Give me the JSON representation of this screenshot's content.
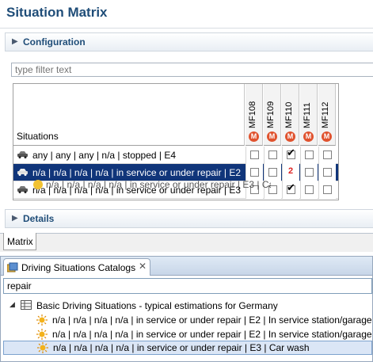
{
  "editor": {
    "title": "Situation Matrix",
    "configuration_label": "Configuration",
    "details_label": "Details",
    "filter_placeholder": "type filter text",
    "matrix_tab_label": "Matrix"
  },
  "matrix": {
    "situations_header": "Situations",
    "columns": [
      {
        "label": "MF108",
        "icon": "M"
      },
      {
        "label": "MF109",
        "icon": "M"
      },
      {
        "label": "MF110",
        "icon": "M"
      },
      {
        "label": "MF111",
        "icon": "M"
      },
      {
        "label": "MF112",
        "icon": "M"
      }
    ],
    "rows": [
      {
        "label": "any | any | any | n/a | stopped | E4",
        "cells": [
          "",
          "",
          "check",
          "",
          ""
        ]
      },
      {
        "label": "n/a | n/a | n/a | n/a | in service or under repair | E2",
        "cells": [
          "",
          "",
          "2",
          "",
          ""
        ]
      },
      {
        "label": "n/a | n/a | n/a | n/a | in service or under repair | E3",
        "cells": [
          "",
          "",
          "check",
          "",
          ""
        ]
      }
    ],
    "drag_ghost_text": "n/a | n/a | n/a | n/a | in service or under repair | E3 | Ca"
  },
  "catalogs": {
    "tab_title": "Driving Situations Catalogs",
    "close_glyph": "✕",
    "search_value": "repair",
    "root": "Basic Driving Situations - typical estimations for Germany",
    "items": [
      "n/a | n/a | n/a | n/a | in service or under repair | E2 | In service station/garage",
      "n/a | n/a | n/a | n/a | in service or under repair | E2 | In service station/garage",
      "n/a | n/a | n/a | n/a | in service or under repair | E3 | Car wash"
    ]
  },
  "colors": {
    "title": "#1f4d78",
    "selection": "#10357a",
    "m_badge": "#e0522e",
    "count_red": "#dd2222"
  }
}
